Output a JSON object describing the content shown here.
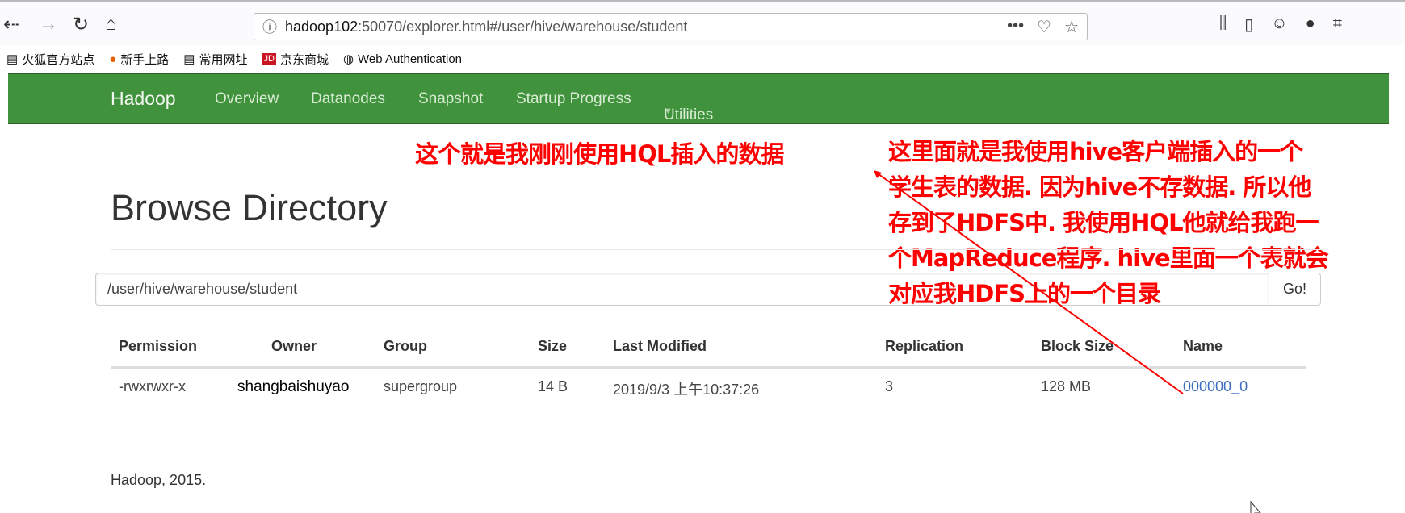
{
  "browser": {
    "url_host": "hadoop102",
    "url_rest": ":50070/explorer.html#/user/hive/warehouse/student",
    "bookmarks": [
      {
        "label": "火狐官方站点",
        "icon": "folder-icon"
      },
      {
        "label": "新手上路",
        "icon": "firefox-icon"
      },
      {
        "label": "常用网址",
        "icon": "folder-icon"
      },
      {
        "label": "京东商城",
        "icon": "jd-icon"
      },
      {
        "label": "Web Authentication",
        "icon": "globe-icon"
      }
    ]
  },
  "navbar": {
    "brand": "Hadoop",
    "items": [
      "Overview",
      "Datanodes",
      "Snapshot",
      "Startup Progress",
      "Utilities"
    ],
    "color": "#41923c"
  },
  "annotations": {
    "left": "这个就是我刚刚使用HQL插入的数据",
    "right": [
      "这里面就是我使用hive客户端插入的一个",
      "学生表的数据. 因为hive不存数据. 所以他",
      "存到了HDFS中. 我使用HQL他就给我跑一",
      "个MapReduce程序. hive里面一个表就会",
      "对应我HDFS上的一个目录"
    ],
    "color": "#ff0000"
  },
  "page": {
    "title": "Browse Directory",
    "path": "/user/hive/warehouse/student",
    "go": "Go!"
  },
  "table": {
    "headers": [
      "Permission",
      "Owner",
      "Group",
      "Size",
      "Last Modified",
      "Replication",
      "Block Size",
      "Name"
    ],
    "rows": [
      [
        "-rwxrwxr-x",
        "shangbaishuyao",
        "supergroup",
        "14 B",
        "2019/9/3 上午10:37:26",
        "3",
        "128 MB",
        "000000_0"
      ]
    ]
  },
  "footer": "Hadoop, 2015."
}
